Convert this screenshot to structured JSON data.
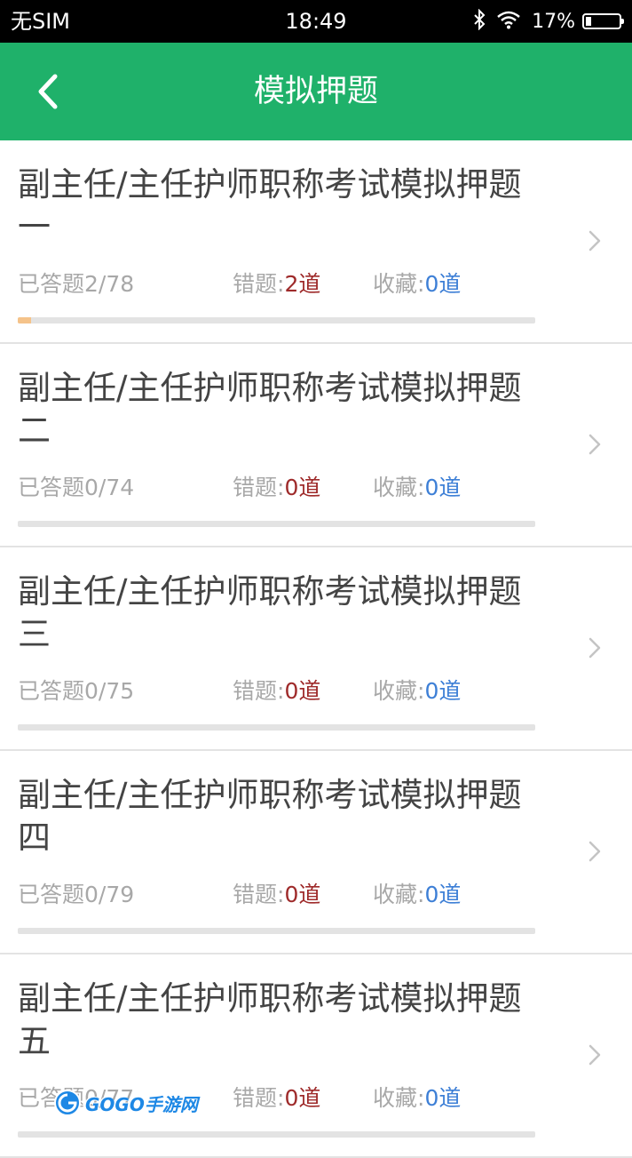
{
  "status_bar": {
    "carrier": "无SIM",
    "time": "18:49",
    "battery_percent_text": "17%",
    "battery_level": 0.17
  },
  "nav": {
    "title": "模拟押题",
    "back_icon": "chevron-left-icon"
  },
  "colors": {
    "nav_green": "#1fb16a",
    "wrong_red": "#9e2a2a",
    "fav_blue": "#3d7fd6",
    "progress_fill": "#f5c38a",
    "progress_track": "#e3e3e3"
  },
  "labels": {
    "answered_prefix": "已答题",
    "wrong_prefix": "错题:",
    "fav_prefix": "收藏:"
  },
  "items": [
    {
      "title": "副主任/主任护师职称考试模拟押题一",
      "answered": "2/78",
      "wrong": "2道",
      "fav": "0道",
      "progress": 0.026
    },
    {
      "title": "副主任/主任护师职称考试模拟押题二",
      "answered": "0/74",
      "wrong": "0道",
      "fav": "0道",
      "progress": 0
    },
    {
      "title": "副主任/主任护师职称考试模拟押题三",
      "answered": "0/75",
      "wrong": "0道",
      "fav": "0道",
      "progress": 0
    },
    {
      "title": "副主任/主任护师职称考试模拟押题四",
      "answered": "0/79",
      "wrong": "0道",
      "fav": "0道",
      "progress": 0
    },
    {
      "title": "副主任/主任护师职称考试模拟押题五",
      "answered": "0/77",
      "wrong": "0道",
      "fav": "0道",
      "progress": 0
    }
  ],
  "watermark": {
    "text": "GOGO手游网"
  }
}
